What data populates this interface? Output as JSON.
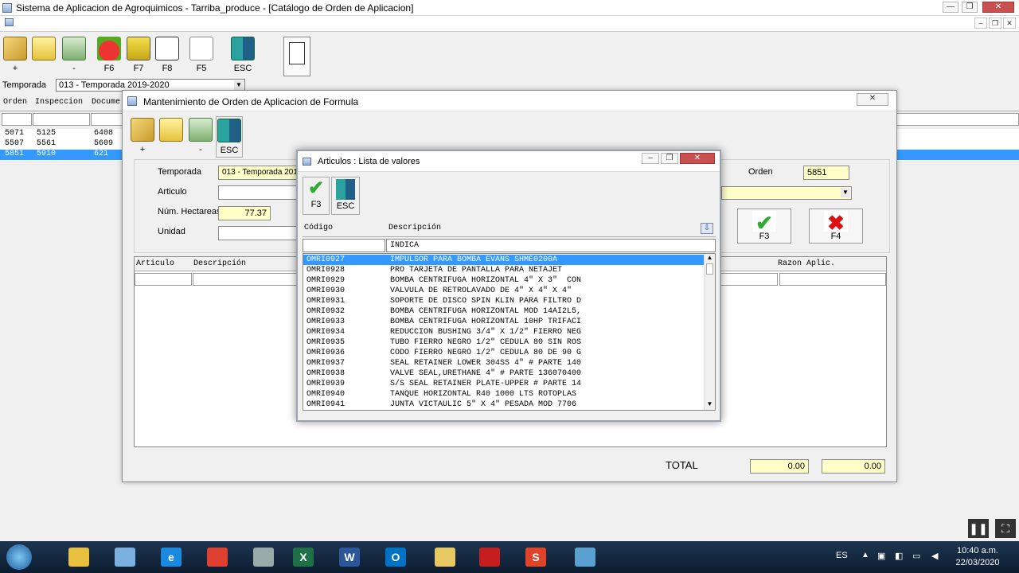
{
  "window": {
    "title": "Sistema de Aplicacion de Agroquimicos - Tarriba_produce - [Catálogo de Orden de Aplicacion]",
    "min": "—",
    "max": "❐",
    "close": "✕"
  },
  "toolbar": [
    {
      "label": "+",
      "icon": "key-icon"
    },
    {
      "label": "",
      "icon": "folder-icon"
    },
    {
      "label": "-",
      "icon": "recycle-bin-icon"
    },
    {
      "label": "F6",
      "icon": "apple-icon"
    },
    {
      "label": "F7",
      "icon": "truck-icon"
    },
    {
      "label": "F8",
      "icon": "notepad-icon"
    },
    {
      "label": "F5",
      "icon": "hand-pointer-icon"
    },
    {
      "label": "ESC",
      "icon": "exit-door-icon"
    }
  ],
  "filters": {
    "temporada_label": "Temporada",
    "temporada_value": "013 - Temporada 2019-2020"
  },
  "grid": {
    "headers": [
      "Orden",
      "Inspeccion",
      "Docume"
    ],
    "rows": [
      [
        "5071",
        "5125",
        "6408"
      ],
      [
        "5507",
        "5561",
        "5609"
      ],
      [
        "5851",
        "5910",
        "621"
      ]
    ],
    "selected_row": 2
  },
  "mant": {
    "title": "Mantenimiento de Orden de Aplicacion de Formula",
    "close": "✕",
    "toolbar": [
      {
        "label": "+",
        "icon": "key-icon"
      },
      {
        "label": "",
        "icon": "folder-icon"
      },
      {
        "label": "-",
        "icon": "recycle-bin-icon"
      },
      {
        "label": "ESC",
        "icon": "exit-door-icon"
      }
    ],
    "temporada_label": "Temporada",
    "temporada_value": "013 - Temporada 201",
    "articulo_label": "Articulo",
    "hectareas_label": "Núm. Hectareas",
    "hectareas_value": "77.37",
    "unidad_label": "Unidad",
    "orden_label": "Orden",
    "orden_value": "5851",
    "ok_label": "F3",
    "cancel_label": "F4",
    "table_headers": [
      "Articulo",
      "Descripción"
    ],
    "razon_header": "Razon Aplic.",
    "total_label": "TOTAL",
    "total_1": "0.00",
    "total_2": "0.00"
  },
  "art": {
    "title": "Articulos : Lista de valores",
    "ok_label": "F3",
    "esc_label": "ESC",
    "col_codigo": "Código",
    "col_descripcion": "Descripción",
    "filter_codigo": "",
    "filter_descripcion": "INDICA",
    "selected_index": 0,
    "items": [
      {
        "codigo": "OMRI0927",
        "descripcion": "IMPULSOR PARA BOMBA EVANS SHME0200A"
      },
      {
        "codigo": "OMRI0928",
        "descripcion": "PRO TARJETA DE PANTALLA PARA NETAJET"
      },
      {
        "codigo": "OMRI0929",
        "descripcion": "BOMBA CENTRIFUGA HORIZONTAL 4\" X 3\"  CON"
      },
      {
        "codigo": "OMRI0930",
        "descripcion": "VALVULA DE RETROLAVADO DE 4\" X 4\" X 4\""
      },
      {
        "codigo": "OMRI0931",
        "descripcion": "SOPORTE DE DISCO SPIN KLIN PARA FILTRO D"
      },
      {
        "codigo": "OMRI0932",
        "descripcion": "BOMBA CENTRIFUGA HORIZONTAL MOD 14AI2L5,"
      },
      {
        "codigo": "OMRI0933",
        "descripcion": "BOMBA CENTRIFUGA HORIZONTAL 10HP TRIFACI"
      },
      {
        "codigo": "OMRI0934",
        "descripcion": "REDUCCION BUSHING 3/4\" X 1/2\" FIERRO NEG"
      },
      {
        "codigo": "OMRI0935",
        "descripcion": "TUBO FIERRO NEGRO 1/2\" CEDULA 80 SIN ROS"
      },
      {
        "codigo": "OMRI0936",
        "descripcion": "CODO FIERRO NEGRO 1/2\" CEDULA 80 DE 90 G"
      },
      {
        "codigo": "OMRI0937",
        "descripcion": "SEAL RETAINER LOWER 304SS 4\" # PARTE 140"
      },
      {
        "codigo": "OMRI0938",
        "descripcion": "VALVE SEAL,URETHANE 4\" # PARTE 136070400"
      },
      {
        "codigo": "OMRI0939",
        "descripcion": "S/S SEAL RETAINER PLATE-UPPER # PARTE 14"
      },
      {
        "codigo": "OMRI0940",
        "descripcion": "TANQUE HORIZONTAL R40 1000 LTS ROTOPLAS"
      },
      {
        "codigo": "OMRI0941",
        "descripcion": "JUNTA VICTAULIC 5\" X 4\" PESADA MOD 7706"
      }
    ]
  },
  "taskbar": {
    "apps": [
      {
        "name": "explorer",
        "glyph": "",
        "color": "#e8c040"
      },
      {
        "name": "remote",
        "glyph": "",
        "color": "#7ab0e0"
      },
      {
        "name": "ie",
        "glyph": "e",
        "color": "#1a8ae0"
      },
      {
        "name": "chrome",
        "glyph": "",
        "color": "#e04030"
      },
      {
        "name": "calculator",
        "glyph": "",
        "color": "#9aa"
      },
      {
        "name": "excel",
        "glyph": "X",
        "color": "#1e7145"
      },
      {
        "name": "word",
        "glyph": "W",
        "color": "#2b579a"
      },
      {
        "name": "outlook",
        "glyph": "O",
        "color": "#0072c6"
      },
      {
        "name": "folder",
        "glyph": "",
        "color": "#e8c860"
      },
      {
        "name": "acrobat",
        "glyph": "",
        "color": "#c41e1e"
      },
      {
        "name": "app",
        "glyph": "S",
        "color": "#e04428"
      },
      {
        "name": "network",
        "glyph": "",
        "color": "#5aa0d0"
      }
    ],
    "lang": "ES",
    "time": "10:40 a.m.",
    "date": "22/03/2020"
  }
}
